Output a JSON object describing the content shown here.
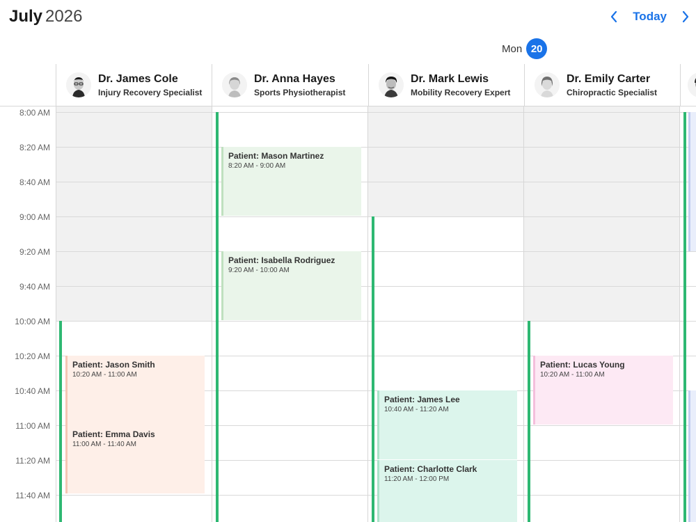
{
  "header": {
    "month": "July",
    "year": "2026",
    "today_label": "Today",
    "prev_icon": "chevron-left-icon",
    "next_icon": "chevron-right-icon",
    "day_name": "Mon",
    "day_number": "20"
  },
  "colors": {
    "accent": "#1a73e8",
    "available": "#2eb872",
    "unavailable": "#f1f1f1",
    "appt_orange_bg": "#feefe8",
    "appt_orange_border": "#f6c6b4",
    "appt_green_bg": "#eaf5ea",
    "appt_green_border": "#bfe0bf",
    "appt_teal_bg": "#dcf5ec",
    "appt_teal_border": "#a9e3c9",
    "appt_pink_bg": "#fde9f4",
    "appt_pink_border": "#f4bfdc"
  },
  "resources": [
    {
      "name": "Dr. James Cole",
      "title": "Injury Recovery Specialist"
    },
    {
      "name": "Dr. Anna Hayes",
      "title": "Sports Physiotherapist"
    },
    {
      "name": "Dr. Mark Lewis",
      "title": "Mobility Recovery Expert"
    },
    {
      "name": "Dr. Emily Carter",
      "title": "Chiropractic Specialist"
    },
    {
      "name": "",
      "title": ""
    }
  ],
  "times": [
    "8:00 AM",
    "8:20 AM",
    "8:40 AM",
    "9:00 AM",
    "9:20 AM",
    "9:40 AM",
    "10:00 AM",
    "10:20 AM",
    "10:40 AM",
    "11:00 AM",
    "11:20 AM",
    "11:40 AM"
  ],
  "appointments": [
    {
      "patient": "Patient: Jason Smith",
      "time": "10:20 AM - 11:00 AM"
    },
    {
      "patient": "Patient: Emma Davis",
      "time": "11:00 AM - 11:40 AM"
    },
    {
      "patient": "Patient: Mason Martinez",
      "time": "8:20 AM - 9:00 AM"
    },
    {
      "patient": "Patient: Isabella Rodriguez",
      "time": "9:20 AM - 10:00 AM"
    },
    {
      "patient": "Patient: James Lee",
      "time": "10:40 AM - 11:20 AM"
    },
    {
      "patient": "Patient: Charlotte Clark",
      "time": "11:20 AM - 12:00 PM"
    },
    {
      "patient": "Patient: Lucas Young",
      "time": "10:20 AM - 11:00 AM"
    }
  ]
}
